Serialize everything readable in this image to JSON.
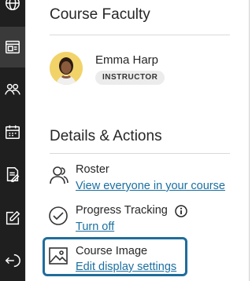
{
  "colors": {
    "rail": "#1f1f1f",
    "link": "#1a6fa0",
    "focus": "#1f6d9c"
  },
  "rail": {
    "icons": [
      "globe-icon",
      "courses-icon",
      "groups-icon",
      "calendar-icon",
      "grades-icon",
      "edit-icon",
      "sign-out-icon"
    ]
  },
  "faculty": {
    "heading": "Course Faculty",
    "name": "Emma Harp",
    "role": "INSTRUCTOR"
  },
  "details": {
    "heading": "Details & Actions",
    "roster": {
      "title": "Roster",
      "link": "View everyone in your course",
      "icon": "users-icon"
    },
    "progress": {
      "title": "Progress Tracking",
      "link": "Turn off",
      "icon": "check-circle-icon"
    },
    "image": {
      "title": "Course Image",
      "link": "Edit display settings",
      "icon": "image-icon"
    }
  }
}
